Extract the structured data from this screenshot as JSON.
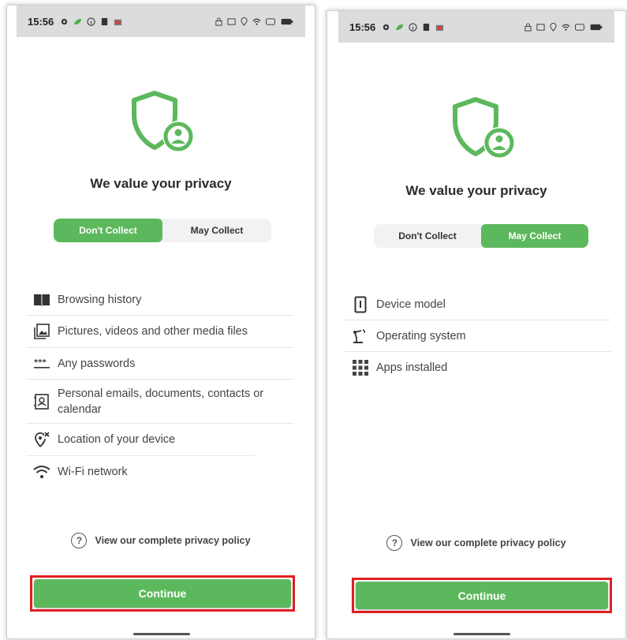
{
  "colors": {
    "accent": "#5cb85c",
    "highlight_border": "#e02020",
    "statusbar_bg": "#dcdcdc"
  },
  "status_bar": {
    "time": "15:56"
  },
  "left_screen": {
    "title": "We value your privacy",
    "toggle": {
      "option1": "Don't Collect",
      "option2": "May Collect",
      "selected": "Don't Collect"
    },
    "items": [
      {
        "icon": "book-icon",
        "label": "Browsing history"
      },
      {
        "icon": "image-icon",
        "label": "Pictures, videos and other media files"
      },
      {
        "icon": "password-icon",
        "label": "Any passwords"
      },
      {
        "icon": "contact-card-icon",
        "label": "Personal emails, documents, contacts or calendar"
      },
      {
        "icon": "location-off-icon",
        "label": "Location of your device"
      },
      {
        "icon": "wifi-icon",
        "label": "Wi-Fi network"
      }
    ],
    "policy_link": "View our complete privacy policy",
    "continue_label": "Continue"
  },
  "right_screen": {
    "title": "We value your privacy",
    "toggle": {
      "option1": "Don't Collect",
      "option2": "May Collect",
      "selected": "May Collect"
    },
    "items": [
      {
        "icon": "phone-info-icon",
        "label": "Device model"
      },
      {
        "icon": "robot-arm-icon",
        "label": "Operating system"
      },
      {
        "icon": "apps-grid-icon",
        "label": "Apps installed"
      }
    ],
    "policy_link": "View our complete privacy policy",
    "continue_label": "Continue"
  }
}
